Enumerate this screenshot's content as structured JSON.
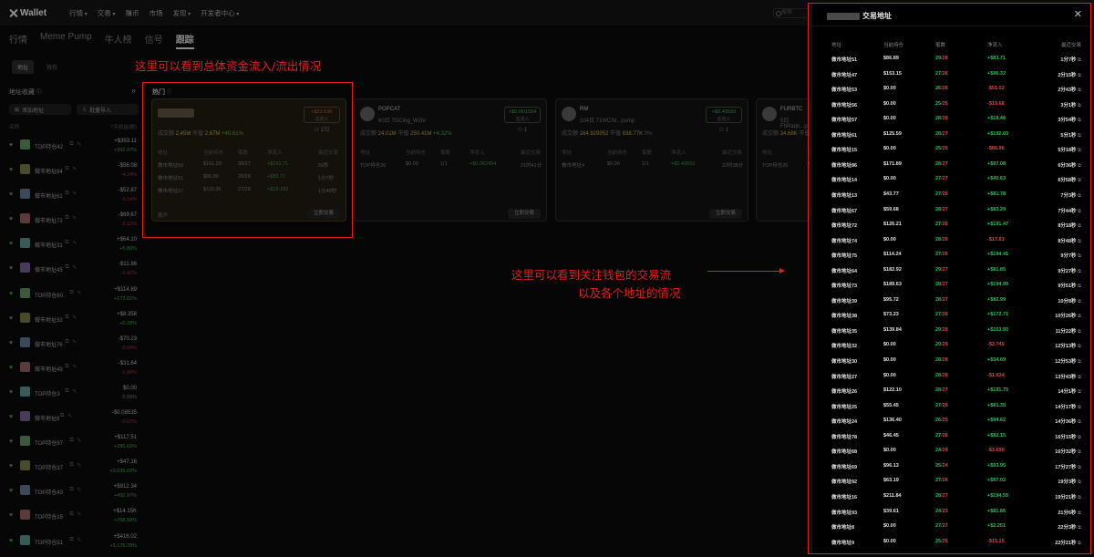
{
  "nav": {
    "logo": "Wallet",
    "items": [
      {
        "label": "行情",
        "dd": true
      },
      {
        "label": "交易",
        "dd": true
      },
      {
        "label": "赚币",
        "dd": false
      },
      {
        "label": "市场",
        "dd": false
      },
      {
        "label": "发现",
        "dd": true
      },
      {
        "label": "开发者中心",
        "dd": true
      }
    ],
    "search_placeholder": "搜索"
  },
  "main_tabs": [
    "行情",
    "Meme Pump",
    "牛人榜",
    "信号",
    "跟踪"
  ],
  "sub_tabs": [
    "地址",
    "钱包"
  ],
  "sidebar": {
    "title": "地址收藏",
    "add_button": "添加地址",
    "import_button": "批量导入",
    "col_name": "名称",
    "col_value": "7天收益(额)",
    "items": [
      {
        "name": "TOP持仓42",
        "value": "+$393.11",
        "pct": "+392.07%",
        "trend": "up"
      },
      {
        "name": "做市地址94",
        "value": "-$56.08",
        "pct": "-4.24%",
        "trend": "down"
      },
      {
        "name": "做市地址61",
        "value": "-$52.87",
        "pct": "-3.14%",
        "trend": "down"
      },
      {
        "name": "做市地址72",
        "value": "-$69.67",
        "pct": "-3.12%",
        "trend": "down"
      },
      {
        "name": "做市地址31",
        "value": "+$64.10",
        "pct": "+5.80%",
        "trend": "up"
      },
      {
        "name": "做市地址45",
        "value": "-$11.86",
        "pct": "-0.42%",
        "trend": "down"
      },
      {
        "name": "TOP持仓60",
        "value": "+$114.89",
        "pct": "+173.02%",
        "trend": "up"
      },
      {
        "name": "做市地址32",
        "value": "+$8.358",
        "pct": "+0.28%",
        "trend": "up"
      },
      {
        "name": "做市地址76",
        "value": "-$70.23",
        "pct": "-3.09%",
        "trend": "down"
      },
      {
        "name": "做市地址49",
        "value": "-$31.64",
        "pct": "-1.80%",
        "trend": "down"
      },
      {
        "name": "TOP持仓3",
        "value": "$0.00",
        "pct": "0.00%",
        "trend": "zero"
      },
      {
        "name": "做市地址8",
        "value": "-$0.08535",
        "pct": "-0.02%",
        "trend": "down"
      },
      {
        "name": "TOP持仓97",
        "value": "+$117.51",
        "pct": "+280.69%",
        "trend": "up"
      },
      {
        "name": "TOP持仓37",
        "value": "+$47.16",
        "pct": "+2,035.69%",
        "trend": "up"
      },
      {
        "name": "TOP持仓43",
        "value": "+$912.34",
        "pct": "+450.97%",
        "trend": "up"
      },
      {
        "name": "TOP持仓15",
        "value": "+$14.15K",
        "pct": "+708.58%",
        "trend": "up"
      },
      {
        "name": "TOP持仓51",
        "value": "+$416.02",
        "pct": "+1,175.78%",
        "trend": "up"
      }
    ]
  },
  "hot": {
    "label": "热门",
    "cards": [
      {
        "name": "",
        "sub": "",
        "flow": "+$23.63K",
        "flow_label": "总流入",
        "people": "172",
        "stats": [
          {
            "t": "成交额 ",
            "c": ""
          },
          {
            "t": "2.45M",
            "c": "o"
          },
          {
            "t": " 市值 ",
            "c": ""
          },
          {
            "t": "2.67M",
            "c": "o"
          },
          {
            "t": " +40.61%",
            "c": "g"
          }
        ],
        "headers": [
          "地址",
          "当前持仓",
          "笔数",
          "净流入",
          "最近交易"
        ],
        "rows": [
          [
            "做市地址50",
            "$161.29",
            "28/27",
            "+$192.71",
            "50秒"
          ],
          [
            "做市地址51",
            "$86.89",
            "29/28",
            "+$83.71",
            "1分7秒"
          ],
          [
            "做市地址17",
            "$110.36",
            "27/28",
            "+$19.183",
            "1分40秒"
          ]
        ],
        "more": "展开",
        "button": "立即交易"
      },
      {
        "name": "POPCAT",
        "sub": "60日 7GCihg_W2hr",
        "flow": "+$0.06/1554",
        "flow_label": "总流入",
        "people": "1",
        "stats": [
          {
            "t": "成交额 ",
            "c": ""
          },
          {
            "t": "24.01M",
            "c": "o"
          },
          {
            "t": " 市值 ",
            "c": ""
          },
          {
            "t": "250.41M",
            "c": "o"
          },
          {
            "t": " +4.32%",
            "c": "g"
          }
        ],
        "headers": [
          "地址",
          "当前持仓",
          "笔数",
          "净流入",
          "最近交易"
        ],
        "rows": [
          [
            "TOP持仓26",
            "$0.00",
            "1/1",
            "+$0.062454",
            "21时41分"
          ]
        ],
        "more": "",
        "button": "立即交易"
      },
      {
        "name": "RM",
        "sub": "104日 71WCNt...pump",
        "flow": "+$0.49593",
        "flow_label": "总流入",
        "people": "1",
        "stats": [
          {
            "t": "成交额 ",
            "c": ""
          },
          {
            "t": "164.929952",
            "c": "o"
          },
          {
            "t": " 市值 ",
            "c": ""
          },
          {
            "t": "838.77K",
            "c": "o"
          },
          {
            "t": " 0%",
            "c": ""
          }
        ],
        "headers": [
          "地址",
          "当前持仓",
          "笔数",
          "净流入",
          "最近交易"
        ],
        "rows": [
          [
            "做市地址4",
            "$0.00",
            "1/1",
            "+$0.49593",
            "22时38分"
          ]
        ],
        "more": "",
        "button": "立即交易"
      },
      {
        "name": "FURBTC",
        "sub": "5日 FhRaqh...pump",
        "flow": "",
        "flow_label": "",
        "people": "",
        "stats": [
          {
            "t": "成交额 ",
            "c": ""
          },
          {
            "t": "34.68K",
            "c": "o"
          },
          {
            "t": " 市值",
            "c": ""
          }
        ],
        "headers": [
          "地址",
          "当前持仓"
        ],
        "rows": [
          [
            "TOP持仓26",
            "$0.00"
          ]
        ],
        "more": "",
        "button": ""
      }
    ]
  },
  "annotations": {
    "top": "这里可以看到总体资金流入/流出情况",
    "right_line1": "这里可以看到关注钱包的交易流",
    "right_line2": "以及各个地址的情况"
  },
  "panel": {
    "title": "交易地址",
    "headers": {
      "addr": "地址",
      "hold": "当前持仓",
      "count": "笔数",
      "flow": "净流入",
      "time": "最近交易"
    },
    "rows": [
      {
        "addr": "做市地址51",
        "hold": "$86.89",
        "buy": "29",
        "sell": "28",
        "flow": "+$83.71",
        "time": "1分7秒"
      },
      {
        "addr": "做市地址47",
        "hold": "$153.15",
        "buy": "27",
        "sell": "26",
        "flow": "+$96.32",
        "time": "2分15秒"
      },
      {
        "addr": "做市地址53",
        "hold": "$0.00",
        "buy": "26",
        "sell": "26",
        "flow": "-$51.02",
        "time": "2分43秒"
      },
      {
        "addr": "做市地址56",
        "hold": "$0.00",
        "buy": "25",
        "sell": "25",
        "flow": "-$19.68",
        "time": "3分1秒"
      },
      {
        "addr": "做市地址57",
        "hold": "$0.00",
        "buy": "28",
        "sell": "28",
        "flow": "+$18.46",
        "time": "3分54秒"
      },
      {
        "addr": "做市地址61",
        "hold": "$125.59",
        "buy": "28",
        "sell": "27",
        "flow": "+$192.03",
        "time": "5分1秒"
      },
      {
        "addr": "做市地址15",
        "hold": "$0.00",
        "buy": "25",
        "sell": "25",
        "flow": "-$86.96",
        "time": "5分18秒"
      },
      {
        "addr": "做市地址86",
        "hold": "$171.89",
        "buy": "28",
        "sell": "27",
        "flow": "+$97.08",
        "time": "6分36秒"
      },
      {
        "addr": "做市地址14",
        "hold": "$0.00",
        "buy": "27",
        "sell": "27",
        "flow": "+$40.63",
        "time": "6分58秒"
      },
      {
        "addr": "做市地址13",
        "hold": "$43.77",
        "buy": "27",
        "sell": "26",
        "flow": "+$81.78",
        "time": "7分3秒"
      },
      {
        "addr": "做市地址67",
        "hold": "$59.68",
        "buy": "28",
        "sell": "27",
        "flow": "+$83.29",
        "time": "7分44秒"
      },
      {
        "addr": "做市地址72",
        "hold": "$126.21",
        "buy": "27",
        "sell": "26",
        "flow": "+$191.47",
        "time": "8分18秒"
      },
      {
        "addr": "做市地址74",
        "hold": "$0.00",
        "buy": "28",
        "sell": "28",
        "flow": "-$17.81",
        "time": "8分48秒"
      },
      {
        "addr": "做市地址75",
        "hold": "$114.24",
        "buy": "27",
        "sell": "26",
        "flow": "+$194.41",
        "time": "9分7秒"
      },
      {
        "addr": "做市地址64",
        "hold": "$182.92",
        "buy": "29",
        "sell": "27",
        "flow": "+$81.85",
        "time": "9分27秒"
      },
      {
        "addr": "做市地址73",
        "hold": "$189.63",
        "buy": "28",
        "sell": "27",
        "flow": "+$194.99",
        "time": "9分51秒"
      },
      {
        "addr": "做市地址39",
        "hold": "$95.72",
        "buy": "28",
        "sell": "27",
        "flow": "+$82.99",
        "time": "10分8秒"
      },
      {
        "addr": "做市地址38",
        "hold": "$73.23",
        "buy": "27",
        "sell": "26",
        "flow": "+$172.71",
        "time": "10分26秒"
      },
      {
        "addr": "做市地址35",
        "hold": "$139.84",
        "buy": "29",
        "sell": "28",
        "flow": "+$103.93",
        "time": "11分22秒"
      },
      {
        "addr": "做市地址32",
        "hold": "$0.00",
        "buy": "29",
        "sell": "29",
        "flow": "-$2.745",
        "time": "12分13秒"
      },
      {
        "addr": "做市地址30",
        "hold": "$0.00",
        "buy": "28",
        "sell": "28",
        "flow": "+$34.69",
        "time": "12分53秒"
      },
      {
        "addr": "做市地址27",
        "hold": "$0.00",
        "buy": "28",
        "sell": "28",
        "flow": "-$1.634",
        "time": "13分43秒"
      },
      {
        "addr": "做市地址26",
        "hold": "$122.10",
        "buy": "28",
        "sell": "27",
        "flow": "+$191.75",
        "time": "14分1秒"
      },
      {
        "addr": "做市地址25",
        "hold": "$55.45",
        "buy": "27",
        "sell": "26",
        "flow": "+$81.35",
        "time": "14分17秒"
      },
      {
        "addr": "做市地址24",
        "hold": "$136.40",
        "buy": "26",
        "sell": "25",
        "flow": "+$94.62",
        "time": "14分36秒"
      },
      {
        "addr": "做市地址78",
        "hold": "$46.45",
        "buy": "27",
        "sell": "26",
        "flow": "+$82.15",
        "time": "16分15秒"
      },
      {
        "addr": "做市地址68",
        "hold": "$0.00",
        "buy": "24",
        "sell": "24",
        "flow": "-$3.690",
        "time": "16分32秒"
      },
      {
        "addr": "做市地址69",
        "hold": "$96.13",
        "buy": "25",
        "sell": "24",
        "flow": "+$93.95",
        "time": "17分27秒"
      },
      {
        "addr": "做市地址92",
        "hold": "$63.19",
        "buy": "27",
        "sell": "26",
        "flow": "+$97.02",
        "time": "19分3秒"
      },
      {
        "addr": "做市地址16",
        "hold": "$211.84",
        "buy": "28",
        "sell": "27",
        "flow": "+$194.55",
        "time": "19分21秒"
      },
      {
        "addr": "做市地址93",
        "hold": "$39.61",
        "buy": "24",
        "sell": "23",
        "flow": "+$81.86",
        "time": "21分6秒"
      },
      {
        "addr": "做市地址8",
        "hold": "$0.00",
        "buy": "27",
        "sell": "27",
        "flow": "+$2.251",
        "time": "22分3秒"
      },
      {
        "addr": "做市地址9",
        "hold": "$0.00",
        "buy": "25",
        "sell": "25",
        "flow": "-$15.15",
        "time": "22分21秒"
      }
    ]
  },
  "colors": {
    "annotation_red": "#e0201a",
    "positive": "#2fbf5a",
    "negative": "#e04848"
  }
}
